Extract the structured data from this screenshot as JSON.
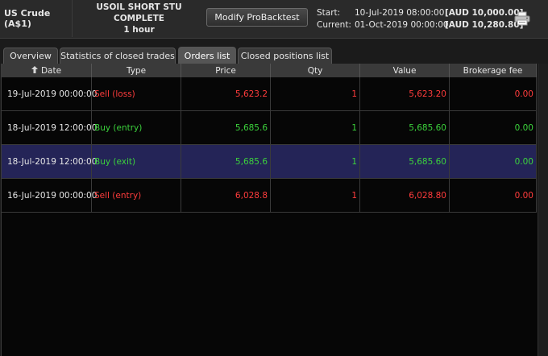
{
  "header": {
    "instrument": "US Crude (A$1)",
    "strategy_name": "USOIL SHORT STU COMPLETE",
    "timeframe": "1 hour",
    "modify_button": "Modify ProBacktest",
    "start_label": "Start:",
    "start_date": "10-Jul-2019 08:00:00",
    "start_amount": "[AUD 10,000.00]",
    "current_label": "Current:",
    "current_date": "01-Oct-2019 00:00:00",
    "current_amount": "[AUD 10,280.80]",
    "print_icon": "print-icon"
  },
  "tabs": [
    {
      "label": "Overview",
      "active": false
    },
    {
      "label": "Statistics of closed trades",
      "active": false
    },
    {
      "label": "Orders list",
      "active": true
    },
    {
      "label": "Closed positions list",
      "active": false
    }
  ],
  "table": {
    "columns": [
      "Date",
      "Type",
      "Price",
      "Qty",
      "Value",
      "Brokerage fee"
    ],
    "sort_icon": "sort-up-icon",
    "rows": [
      {
        "date": "19-Jul-2019 00:00:00",
        "type": "Sell (loss)",
        "price": "5,623.2",
        "qty": "1",
        "value": "5,623.20",
        "fee": "0.00",
        "color": "#ff3c3c",
        "selected": false
      },
      {
        "date": "18-Jul-2019 12:00:00",
        "type": "Buy (entry)",
        "price": "5,685.6",
        "qty": "1",
        "value": "5,685.60",
        "fee": "0.00",
        "color": "#3cd23c",
        "selected": false
      },
      {
        "date": "18-Jul-2019 12:00:00",
        "type": "Buy (exit)",
        "price": "5,685.6",
        "qty": "1",
        "value": "5,685.60",
        "fee": "0.00",
        "color": "#3cd23c",
        "selected": true
      },
      {
        "date": "16-Jul-2019 00:00:00",
        "type": "Sell (entry)",
        "price": "6,028.8",
        "qty": "1",
        "value": "6,028.80",
        "fee": "0.00",
        "color": "#ff3c3c",
        "selected": false
      }
    ]
  }
}
